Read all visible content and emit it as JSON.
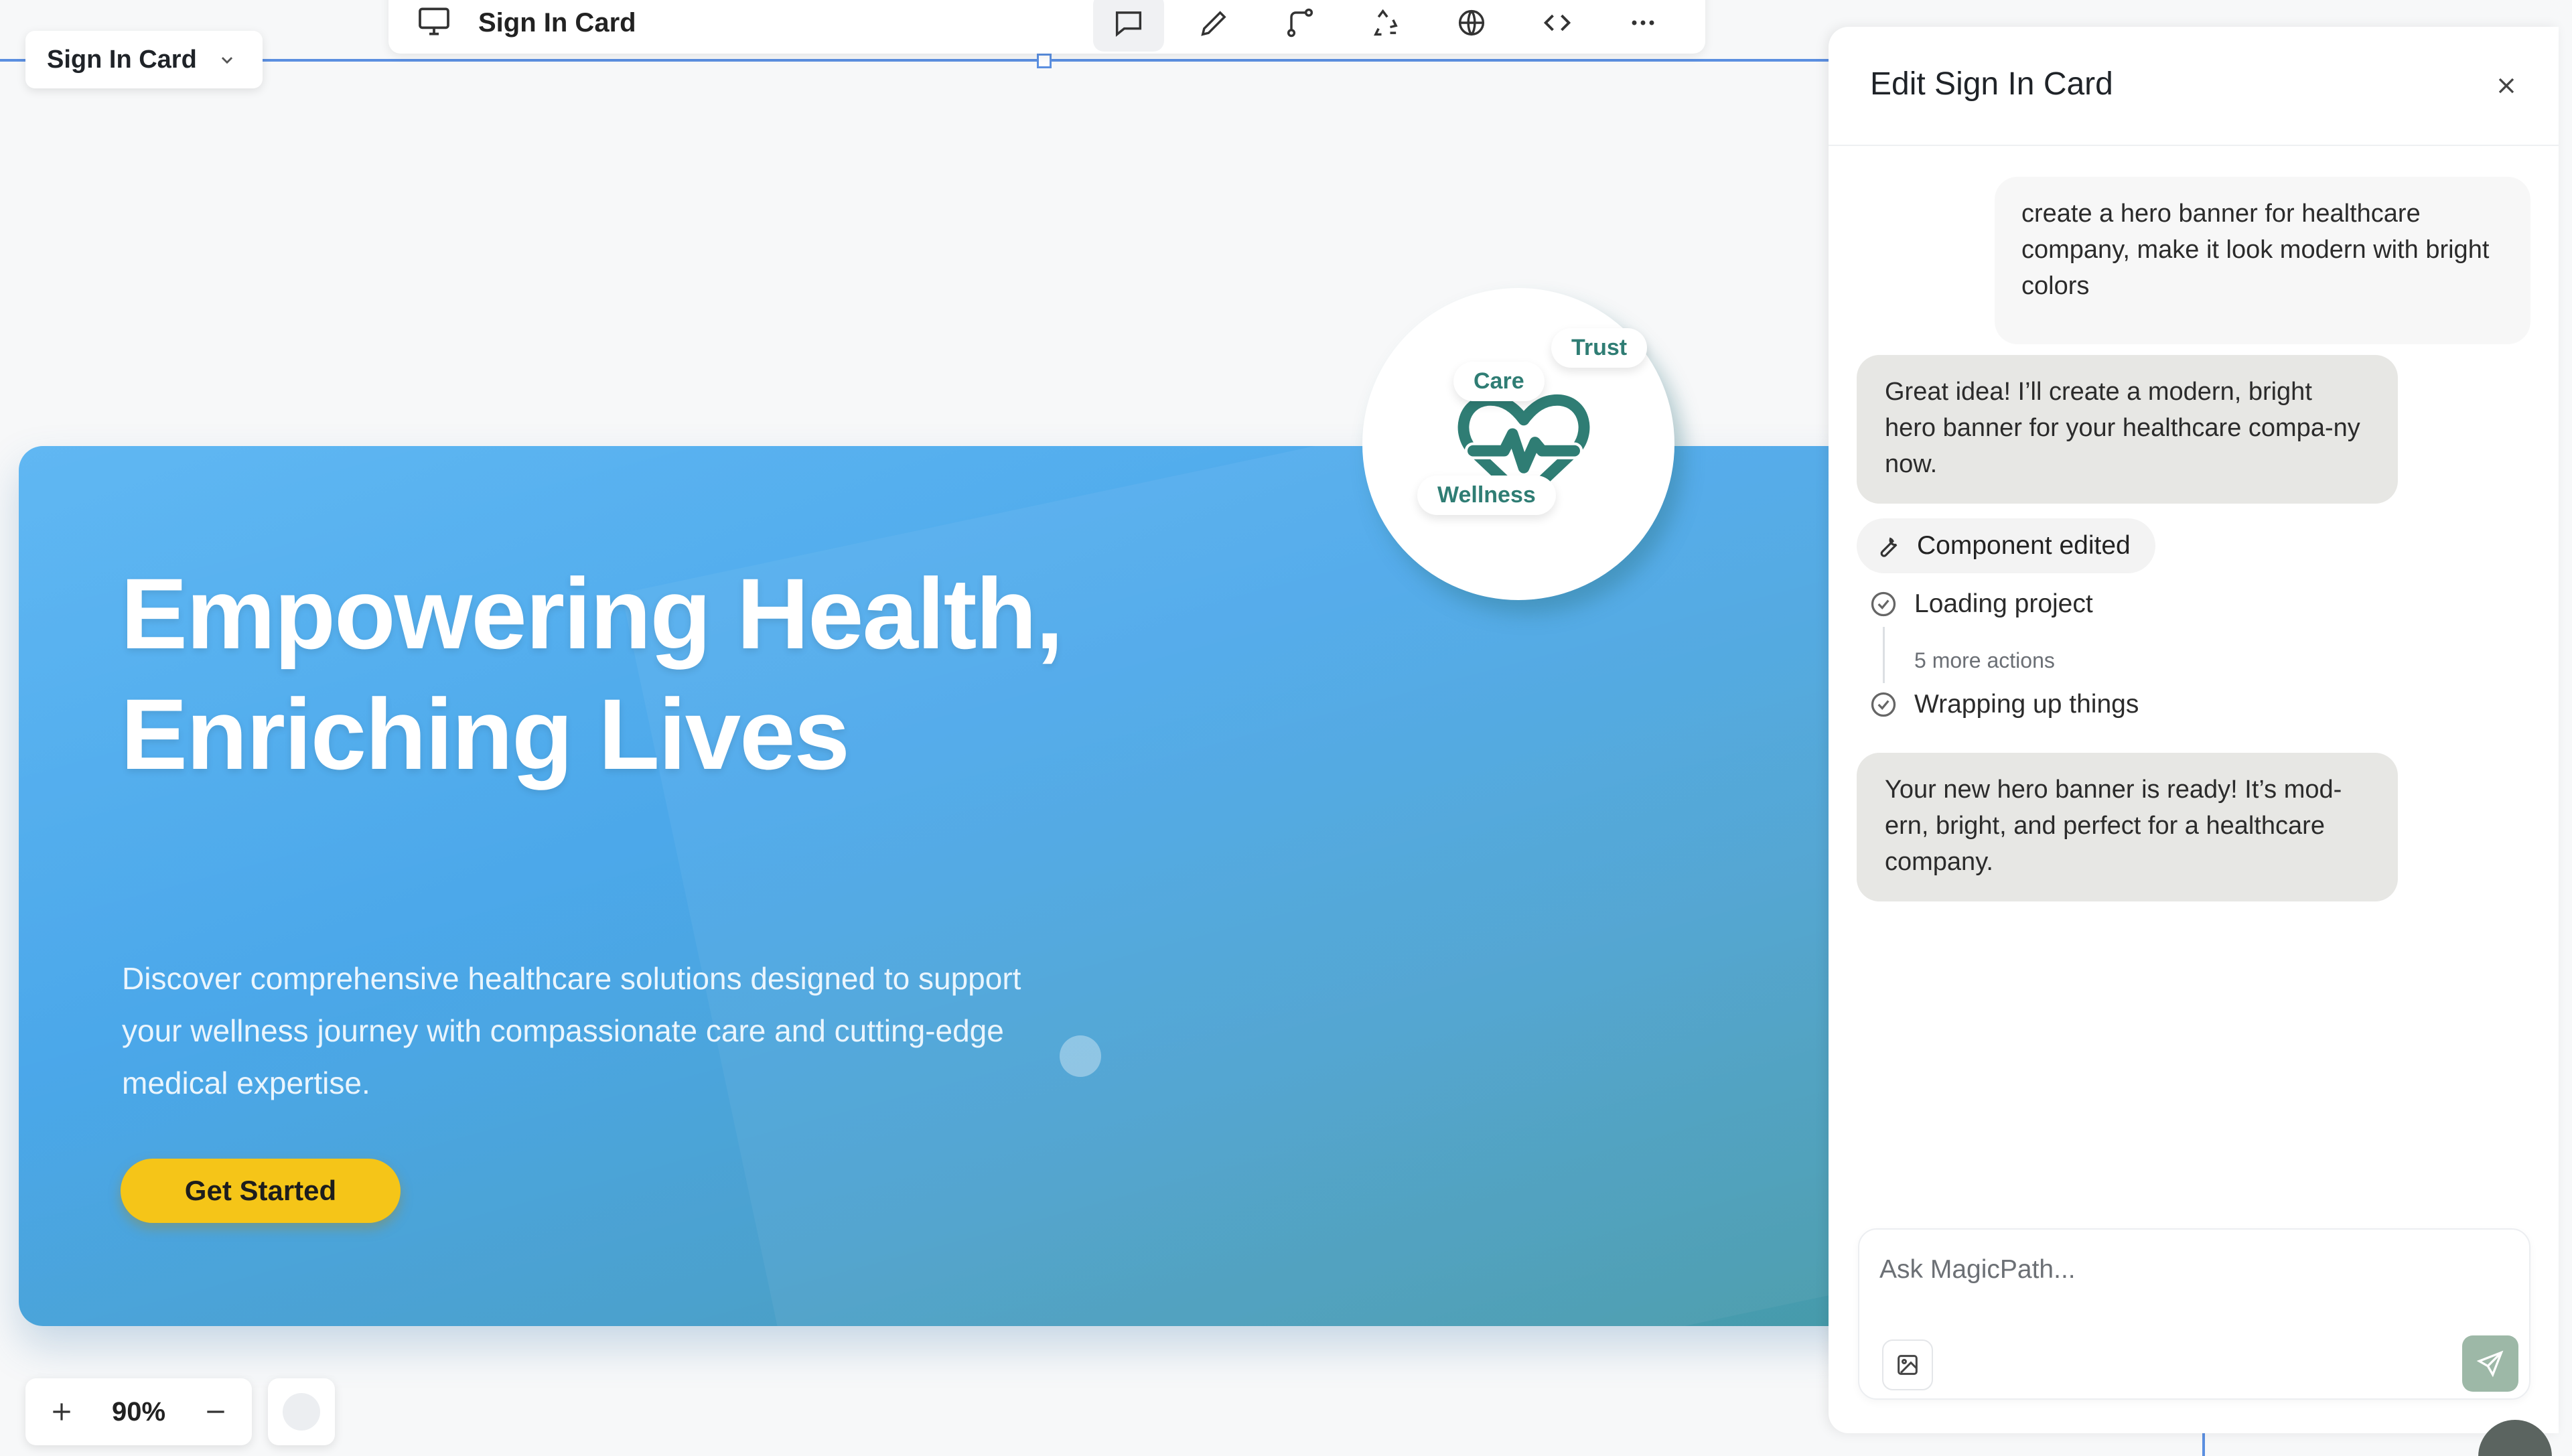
{
  "canvas": {
    "component_select": {
      "label": "Sign In Card"
    },
    "toolbar": {
      "title": "Sign In Card",
      "icons": [
        "screen-icon",
        "comment-icon",
        "pen-icon",
        "branch-icon",
        "recycle-icon",
        "globe-icon",
        "code-icon",
        "more-icon"
      ]
    },
    "zoom": {
      "level": "90%"
    }
  },
  "hero": {
    "title": "Empowering Health, Enriching Lives",
    "description": "Discover comprehensive healthcare solutions designed to support your wellness journey with compassionate care and cutting-edge medical expertise.",
    "cta": "Get Started",
    "badges": {
      "care": "Care",
      "trust": "Trust",
      "wellness": "Wellness"
    },
    "colors": {
      "gradient_start": "#56b3f2",
      "gradient_end": "#4aa3b3",
      "cta": "#f5c518",
      "badge_text": "#2f7d74"
    }
  },
  "panel": {
    "title": "Edit Sign In Card",
    "messages": {
      "user_1": "create a hero banner for healthcare company, make it look modern with bright colors",
      "ai_1": "Great idea! I’ll create a modern, bright hero banner for your healthcare compa-ny now.",
      "ai_2": "Your new hero banner is ready! It’s mod-ern, bright, and perfect for a healthcare company."
    },
    "chip": "Component edited",
    "steps": {
      "step_1": "Loading project",
      "more": "5 more actions",
      "step_2": "Wrapping up things"
    },
    "composer": {
      "placeholder": "Ask MagicPath..."
    }
  }
}
